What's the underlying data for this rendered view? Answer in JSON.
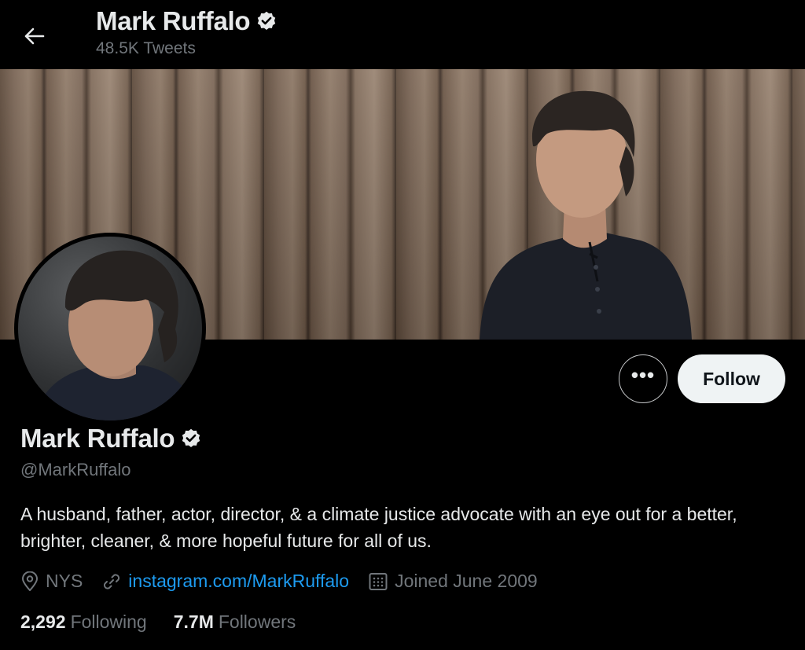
{
  "header": {
    "title": "Mark Ruffalo",
    "tweet_count": "48.5K Tweets"
  },
  "profile": {
    "name": "Mark Ruffalo",
    "handle": "@MarkRuffalo",
    "bio": "A husband, father, actor, director, & a climate justice advocate with an eye out for a better, brighter, cleaner, & more hopeful future for all of us.",
    "location": "NYS",
    "website": "instagram.com/MarkRuffalo",
    "joined": "Joined June 2009",
    "verified": true
  },
  "actions": {
    "more_label": "•••",
    "follow_label": "Follow"
  },
  "stats": {
    "following_count": "2,292",
    "following_label": "Following",
    "followers_count": "7.7M",
    "followers_label": "Followers"
  },
  "colors": {
    "background": "#000000",
    "text_primary": "#e7e9ea",
    "text_secondary": "#71767b",
    "link": "#1d9bf0",
    "follow_button_bg": "#eff3f4"
  },
  "icons": [
    "back-arrow-icon",
    "verified-badge-icon",
    "location-pin-icon",
    "link-icon",
    "calendar-icon",
    "more-icon"
  ]
}
